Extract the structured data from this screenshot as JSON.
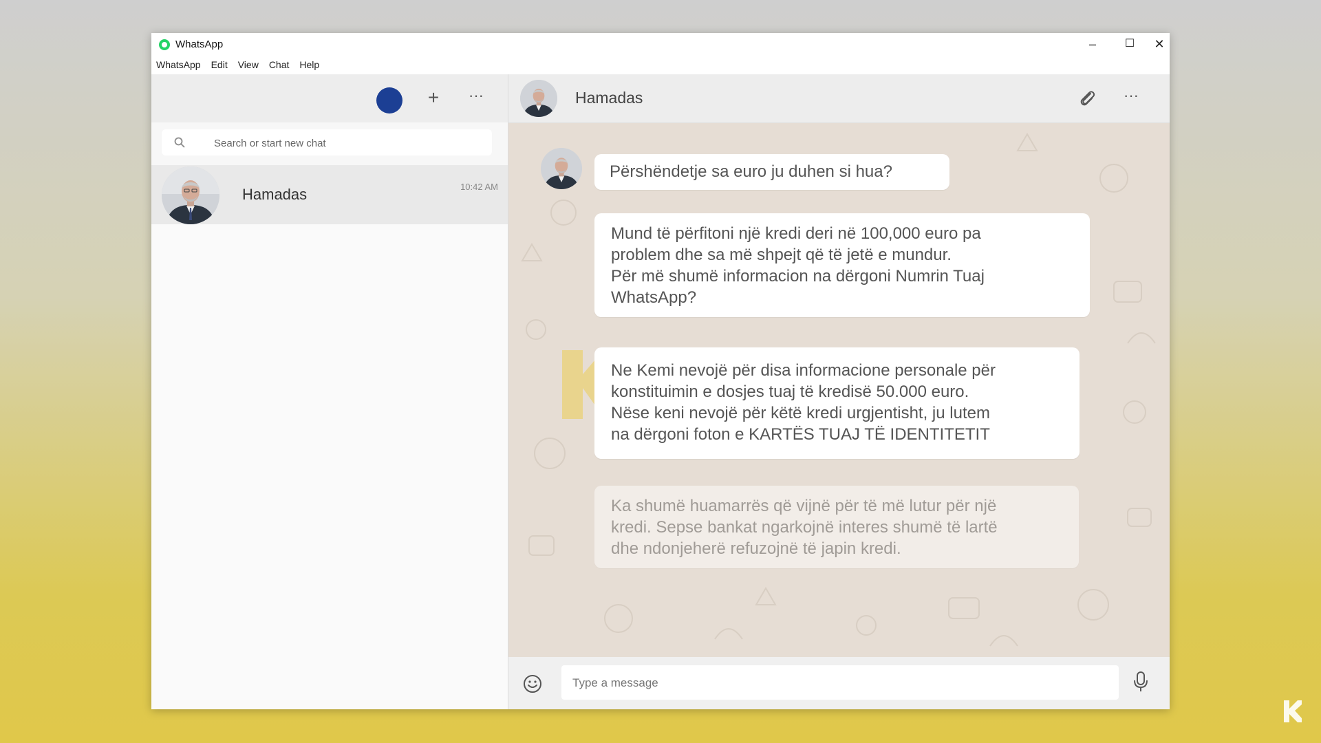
{
  "window": {
    "title": "WhatsApp",
    "controls": {
      "minimize": "–",
      "maximize": "☐",
      "close": "✕"
    }
  },
  "menu": [
    "WhatsApp",
    "Edit",
    "View",
    "Chat",
    "Help"
  ],
  "sidebar": {
    "header": {
      "new_chat_icon": "plus-icon",
      "more_icon": "more-icon",
      "new_chat_glyph": "+",
      "more_glyph": "···"
    },
    "search": {
      "placeholder": "Search or start new chat"
    },
    "chats": [
      {
        "name": "Hamadas",
        "time": "10:42 AM"
      }
    ]
  },
  "chat": {
    "contact_name": "Hamadas",
    "more_glyph": "···",
    "messages": [
      {
        "lines": [
          "Përshëndetje sa euro ju duhen si hua?"
        ]
      },
      {
        "lines": [
          "Mund të përfitoni një kredi deri në 100,000 euro pa",
          "problem dhe sa më shpejt që të jetë e mundur.",
          "Për më shumë informacion na dërgoni Numrin Tuaj",
          "WhatsApp?"
        ]
      },
      {
        "lines": [
          "Ne Kemi nevojë për disa informacione personale për",
          "konstituimin e dosjes tuaj të kredisë 50.000 euro.",
          "Nëse keni nevojë për këtë kredi urgjentisht, ju lutem",
          "na dërgoni foton e KARTËS TUAJ TË IDENTITETIT"
        ]
      },
      {
        "lines": [
          "Ka shumë huamarrës që vijnë për të më lutur për një",
          "kredi. Sepse bankat ngarkojnë interes shumë të lartë",
          "dhe ndonjeherë refuzojnë të japin kredi."
        ]
      }
    ],
    "composer": {
      "placeholder": "Type a message"
    }
  },
  "colors": {
    "chat_background": "#e6ddd4",
    "bubble": "#ffffff",
    "header": "#ededed",
    "accent": "#25d366"
  }
}
